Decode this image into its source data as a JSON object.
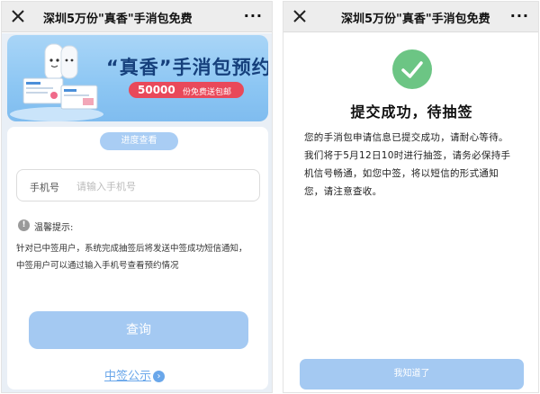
{
  "left": {
    "nav": {
      "title": "深圳5万份\"真香\"手消包免费",
      "more_label": "···"
    },
    "banner": {
      "title": "“真香”手消包预约",
      "pill_number": "50000",
      "pill_text": "份免费送包邮"
    },
    "progress_button": "进度查看",
    "phone_field": {
      "label": "手机号",
      "placeholder": "请输入手机号"
    },
    "tip": {
      "icon_glyph": "!",
      "title": "温馨提示:",
      "lines": [
        "针对已中签用户，系统完成抽签后将发送中签成功短信通知，",
        "中签用户可以通过输入手机号查看预约情况"
      ]
    },
    "query_button": "查询",
    "winners_link": "中签公示",
    "winners_arrow": "›"
  },
  "right": {
    "nav": {
      "title": "深圳5万份\"真香\"手消包免费",
      "more_label": "···"
    },
    "success_title": "提交成功，待抽签",
    "message_lines": [
      "您的手消包申请信息已提交成功，请耐心等待。",
      "我们将于5月12日10时进行抽签，请务必保持手",
      "机信号畅通，如您中签，将以短信的形式通知",
      "您，请注意查收。"
    ],
    "ack_button": "我知道了"
  },
  "icons": [
    "close-icon",
    "more-icon",
    "info-icon",
    "chevron-right-icon",
    "checkmark-icon"
  ],
  "colors": {
    "accent_button": "#a4c9f2",
    "link": "#6aa7ea",
    "success": "#6cc584",
    "banner_pill": "#e9495a",
    "banner_title": "#16407c",
    "nav_bar": "#ededed"
  }
}
